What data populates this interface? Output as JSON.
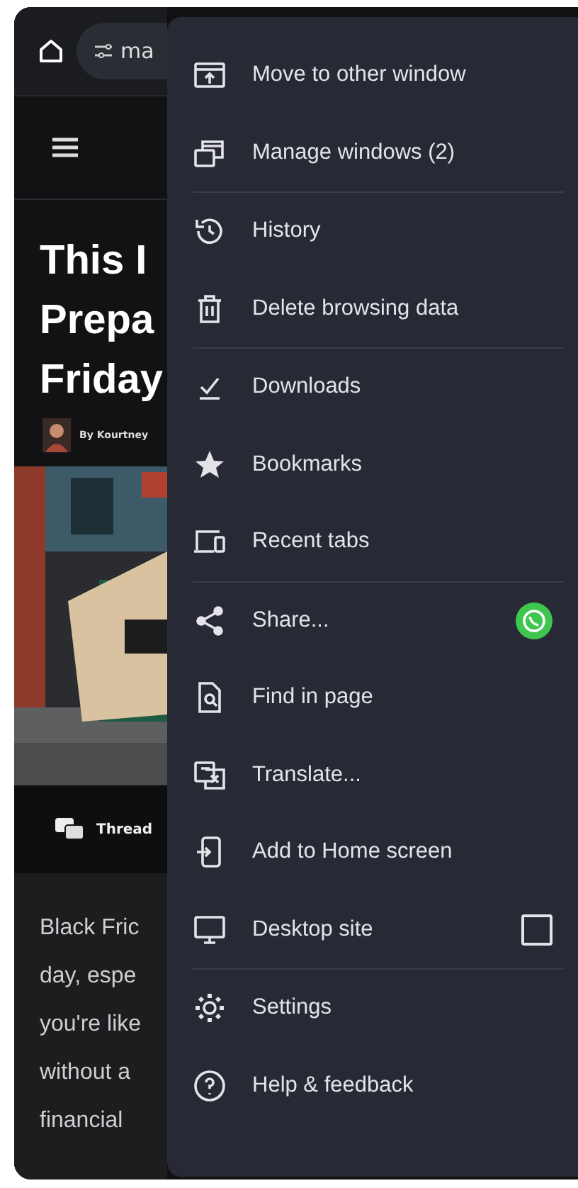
{
  "toolbar": {
    "url": "ma"
  },
  "article": {
    "title_lines": [
      "This I",
      "Prepa",
      "Friday"
    ],
    "byline": "By Kourtney",
    "share_label": "Thread",
    "body_lines": [
      "Black Fric",
      "day, espe",
      "you're like",
      "without a",
      "financial"
    ]
  },
  "menu": {
    "groups": [
      {
        "items": [
          {
            "label": "Move to other window",
            "kind": "plain"
          },
          {
            "label": "Manage windows (2)",
            "kind": "plain"
          }
        ]
      },
      {
        "items": [
          {
            "label": "History",
            "kind": "plain"
          },
          {
            "label": "Delete browsing data",
            "kind": "plain"
          }
        ]
      },
      {
        "items": [
          {
            "label": "Downloads",
            "kind": "plain"
          },
          {
            "label": "Bookmarks",
            "kind": "plain"
          },
          {
            "label": "Recent tabs",
            "kind": "plain"
          }
        ]
      },
      {
        "items": [
          {
            "label": "Share...",
            "kind": "share"
          },
          {
            "label": "Find in page",
            "kind": "plain"
          },
          {
            "label": "Translate...",
            "kind": "plain"
          },
          {
            "label": "Add to Home screen",
            "kind": "plain"
          },
          {
            "label": "Desktop site",
            "kind": "checkbox",
            "checked": false
          }
        ]
      },
      {
        "items": [
          {
            "label": "Settings",
            "kind": "plain"
          },
          {
            "label": "Help & feedback",
            "kind": "plain"
          }
        ]
      }
    ]
  }
}
